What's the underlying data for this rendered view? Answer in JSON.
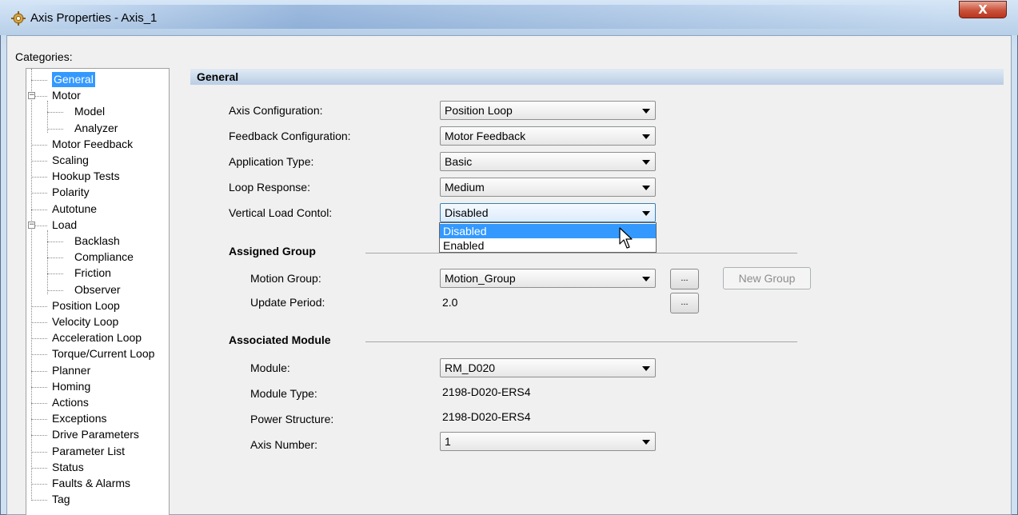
{
  "window": {
    "title": "Axis Properties - Axis_1",
    "close_glyph": "X"
  },
  "categories": {
    "label": "Categories:",
    "items": [
      {
        "label": "General",
        "level": 0,
        "selected": true
      },
      {
        "label": "Motor",
        "level": 0,
        "expanded": true
      },
      {
        "label": "Model",
        "level": 1
      },
      {
        "label": "Analyzer",
        "level": 1
      },
      {
        "label": "Motor Feedback",
        "level": 0
      },
      {
        "label": "Scaling",
        "level": 0
      },
      {
        "label": "Hookup Tests",
        "level": 0
      },
      {
        "label": "Polarity",
        "level": 0
      },
      {
        "label": "Autotune",
        "level": 0
      },
      {
        "label": "Load",
        "level": 0,
        "expanded": true
      },
      {
        "label": "Backlash",
        "level": 1
      },
      {
        "label": "Compliance",
        "level": 1
      },
      {
        "label": "Friction",
        "level": 1
      },
      {
        "label": "Observer",
        "level": 1
      },
      {
        "label": "Position Loop",
        "level": 0
      },
      {
        "label": "Velocity Loop",
        "level": 0
      },
      {
        "label": "Acceleration Loop",
        "level": 0
      },
      {
        "label": "Torque/Current Loop",
        "level": 0
      },
      {
        "label": "Planner",
        "level": 0
      },
      {
        "label": "Homing",
        "level": 0
      },
      {
        "label": "Actions",
        "level": 0
      },
      {
        "label": "Exceptions",
        "level": 0
      },
      {
        "label": "Drive Parameters",
        "level": 0
      },
      {
        "label": "Parameter List",
        "level": 0
      },
      {
        "label": "Status",
        "level": 0
      },
      {
        "label": "Faults & Alarms",
        "level": 0
      },
      {
        "label": "Tag",
        "level": 0
      }
    ]
  },
  "general": {
    "title": "General",
    "axis_configuration": {
      "label": "Axis Configuration:",
      "value": "Position Loop"
    },
    "feedback_configuration": {
      "label": "Feedback Configuration:",
      "value": "Motor Feedback"
    },
    "application_type": {
      "label": "Application Type:",
      "value": "Basic"
    },
    "loop_response": {
      "label": "Loop Response:",
      "value": "Medium"
    },
    "vertical_load_control": {
      "label": "Vertical Load Contol:",
      "value": "Disabled",
      "options": [
        "Disabled",
        "Enabled"
      ]
    }
  },
  "assigned_group": {
    "title": "Assigned Group",
    "motion_group": {
      "label": "Motion Group:",
      "value": "Motion_Group"
    },
    "update_period": {
      "label": "Update Period:",
      "value": "2.0"
    },
    "browse_label": "...",
    "new_group_label": "New Group"
  },
  "associated_module": {
    "title": "Associated Module",
    "module": {
      "label": "Module:",
      "value": "RM_D020"
    },
    "module_type": {
      "label": "Module Type:",
      "value": "2198-D020-ERS4"
    },
    "power_structure": {
      "label": "Power Structure:",
      "value": "2198-D020-ERS4"
    },
    "axis_number": {
      "label": "Axis Number:",
      "value": "1"
    }
  },
  "icons": [
    "app-gear-icon",
    "close-icon",
    "expand-collapse-icon",
    "dropdown-arrow-icon",
    "mouse-cursor-icon"
  ],
  "colors": {
    "selection": "#3399ff",
    "close_button": "#c9523b",
    "header_bar": "#b9cde4"
  }
}
